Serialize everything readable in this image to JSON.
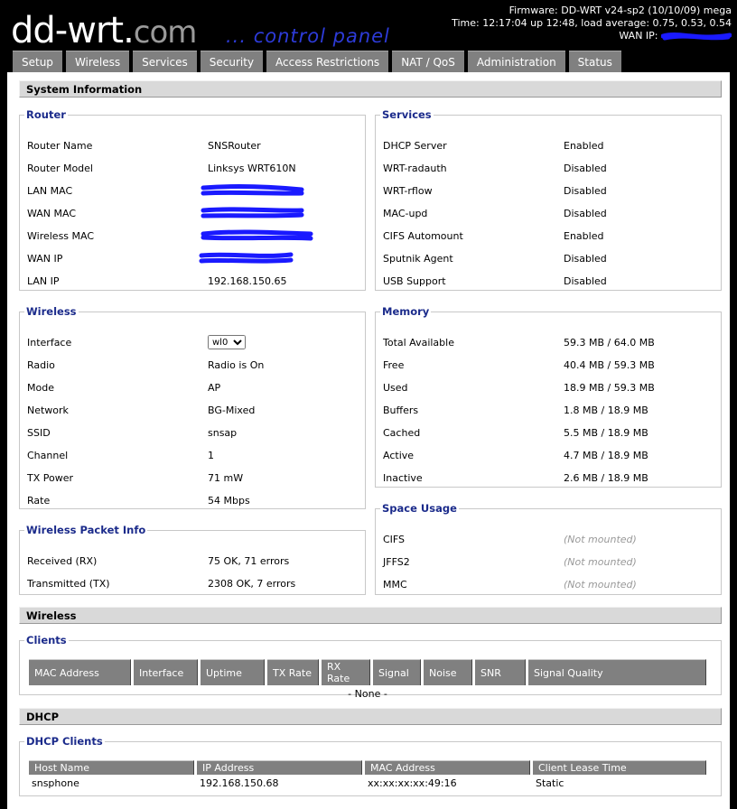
{
  "header": {
    "logo_text": "dd-wrt",
    "logo_dot": ".",
    "logo_com": "com",
    "panel_text": "... control panel",
    "firmware": "Firmware: DD-WRT v24-sp2 (10/10/09) mega",
    "time": "Time: 12:17:04 up 12:48, load average: 0.75, 0.53, 0.54",
    "wan_ip_label": "WAN IP:"
  },
  "tabs": [
    {
      "label": "Setup"
    },
    {
      "label": "Wireless"
    },
    {
      "label": "Services"
    },
    {
      "label": "Security"
    },
    {
      "label": "Access Restrictions"
    },
    {
      "label": "NAT / QoS"
    },
    {
      "label": "Administration"
    },
    {
      "label": "Status"
    }
  ],
  "system_information": {
    "title": "System Information",
    "router": {
      "legend": "Router",
      "rows": [
        {
          "label": "Router Name",
          "value": "SNSRouter"
        },
        {
          "label": "Router Model",
          "value": "Linksys WRT610N"
        },
        {
          "label": "LAN MAC",
          "value": ""
        },
        {
          "label": "WAN MAC",
          "value": ""
        },
        {
          "label": "Wireless MAC",
          "value": ""
        },
        {
          "label": "WAN IP",
          "value": ""
        },
        {
          "label": "LAN IP",
          "value": "192.168.150.65"
        }
      ]
    },
    "services": {
      "legend": "Services",
      "rows": [
        {
          "label": "DHCP Server",
          "value": "Enabled"
        },
        {
          "label": "WRT-radauth",
          "value": "Disabled"
        },
        {
          "label": "WRT-rflow",
          "value": "Disabled"
        },
        {
          "label": "MAC-upd",
          "value": "Disabled"
        },
        {
          "label": "CIFS Automount",
          "value": "Enabled"
        },
        {
          "label": "Sputnik Agent",
          "value": "Disabled"
        },
        {
          "label": "USB Support",
          "value": "Disabled"
        }
      ]
    },
    "wireless": {
      "legend": "Wireless",
      "interface_label": "Interface",
      "interface_value": "wl0",
      "rows": [
        {
          "label": "Radio",
          "value": "Radio is On"
        },
        {
          "label": "Mode",
          "value": "AP"
        },
        {
          "label": "Network",
          "value": "BG-Mixed"
        },
        {
          "label": "SSID",
          "value": "snsap"
        },
        {
          "label": "Channel",
          "value": "1"
        },
        {
          "label": "TX Power",
          "value": "71 mW"
        },
        {
          "label": "Rate",
          "value": "54 Mbps"
        }
      ]
    },
    "memory": {
      "legend": "Memory",
      "rows": [
        {
          "label": "Total Available",
          "value": "59.3 MB / 64.0 MB"
        },
        {
          "label": "Free",
          "value": "40.4 MB / 59.3 MB"
        },
        {
          "label": "Used",
          "value": "18.9 MB / 59.3 MB"
        },
        {
          "label": "Buffers",
          "value": "1.8 MB / 18.9 MB"
        },
        {
          "label": "Cached",
          "value": "5.5 MB / 18.9 MB"
        },
        {
          "label": "Active",
          "value": "4.7 MB / 18.9 MB"
        },
        {
          "label": "Inactive",
          "value": "2.6 MB / 18.9 MB"
        }
      ]
    },
    "packet_info": {
      "legend": "Wireless Packet Info",
      "rows": [
        {
          "label": "Received (RX)",
          "value": "75 OK, 71 errors"
        },
        {
          "label": "Transmitted (TX)",
          "value": "2308 OK, 7 errors"
        }
      ]
    },
    "space_usage": {
      "legend": "Space Usage",
      "rows": [
        {
          "label": "CIFS",
          "value": "(Not mounted)"
        },
        {
          "label": "JFFS2",
          "value": "(Not mounted)"
        },
        {
          "label": "MMC",
          "value": "(Not mounted)"
        }
      ]
    }
  },
  "wireless_section": {
    "title": "Wireless",
    "clients_legend": "Clients",
    "columns": [
      "MAC Address",
      "Interface",
      "Uptime",
      "TX Rate",
      "RX Rate",
      "Signal",
      "Noise",
      "SNR",
      "Signal Quality"
    ],
    "empty_text": "- None -"
  },
  "dhcp_section": {
    "title": "DHCP",
    "clients_legend": "DHCP Clients",
    "columns": [
      "Host Name",
      "IP Address",
      "MAC Address",
      "Client Lease Time"
    ],
    "rows": [
      {
        "host": "snsphone",
        "ip": "192.168.150.68",
        "mac": "xx:xx:xx:xx:49:16",
        "lease": "Static"
      }
    ]
  },
  "colors": {
    "legend": "#1b2b8b",
    "tab": "#808080",
    "redaction": "#1a1aff"
  }
}
